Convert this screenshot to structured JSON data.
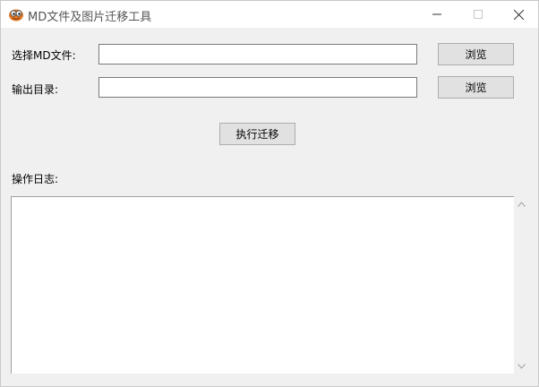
{
  "window": {
    "title": "MD文件及图片迁移工具",
    "icon": "cartoon-face-icon"
  },
  "form": {
    "md_file_label": "选择MD文件:",
    "md_file_value": "",
    "md_browse_label": "浏览",
    "output_dir_label": "输出目录:",
    "output_dir_value": "",
    "output_browse_label": "浏览"
  },
  "actions": {
    "run_label": "执行迁移"
  },
  "log": {
    "label": "操作日志:",
    "content": ""
  }
}
